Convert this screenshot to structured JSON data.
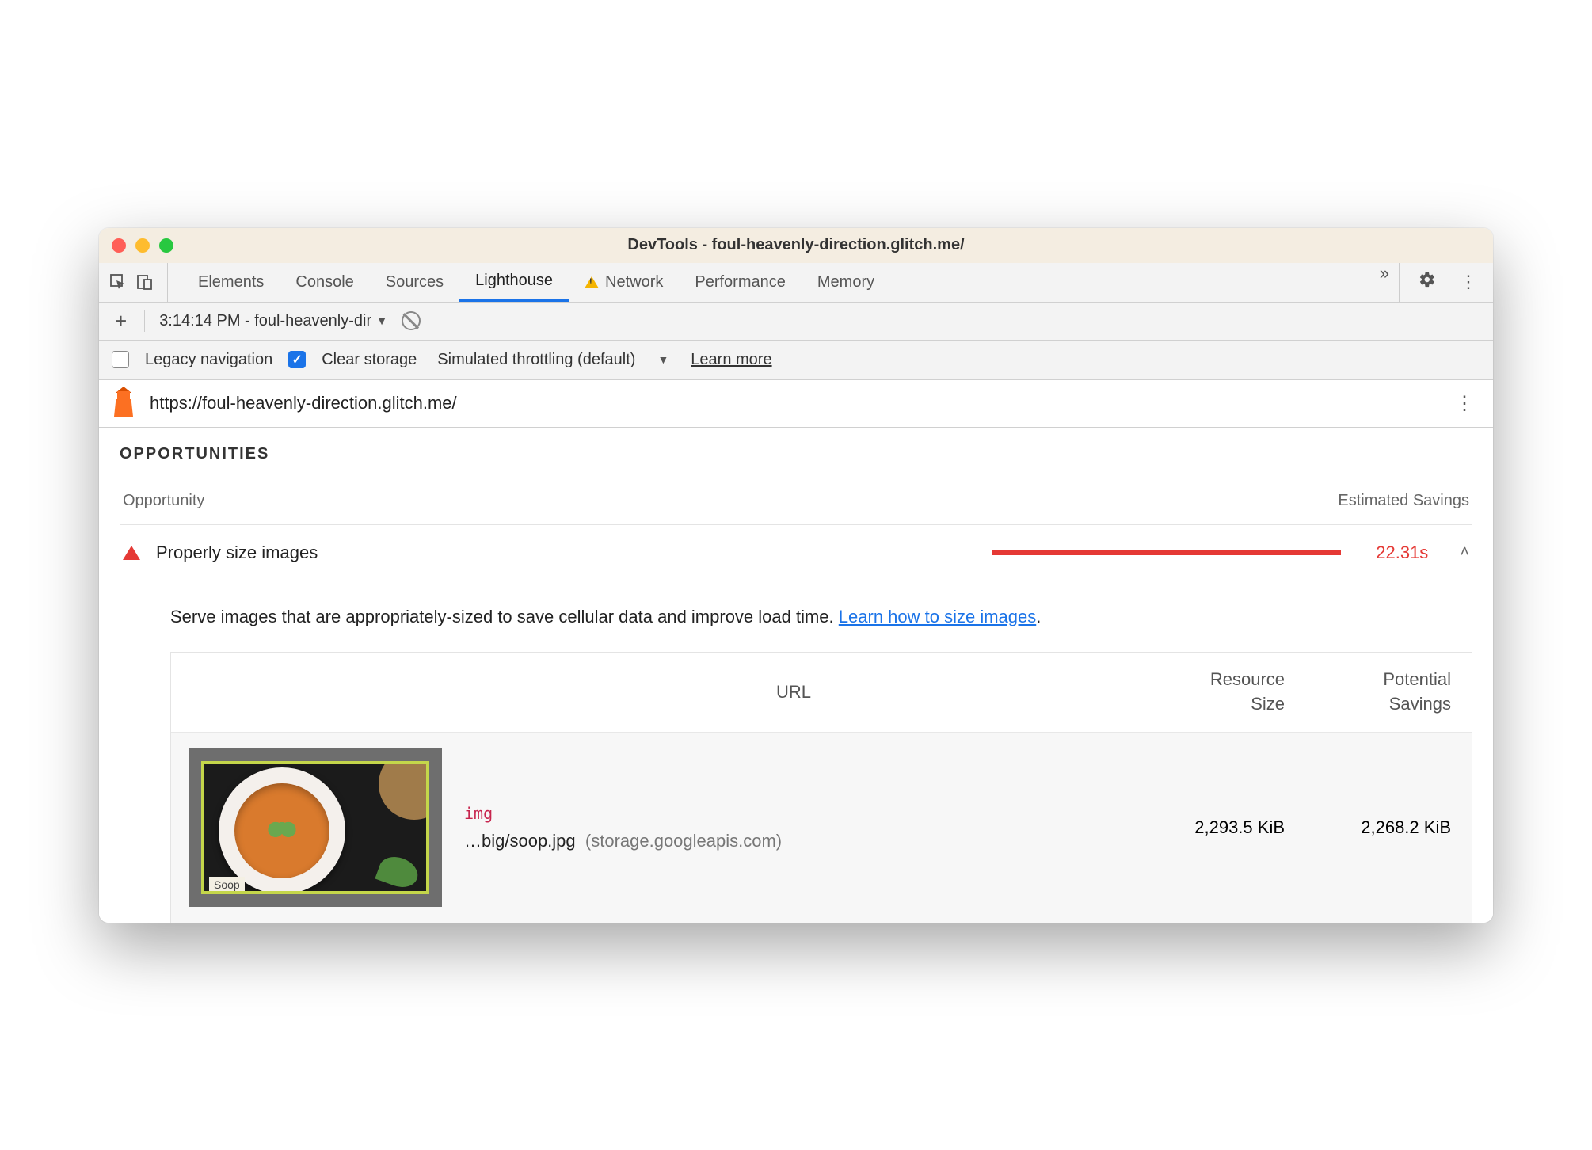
{
  "window": {
    "title": "DevTools - foul-heavenly-direction.glitch.me/"
  },
  "tabs": {
    "elements": "Elements",
    "console": "Console",
    "sources": "Sources",
    "lighthouse": "Lighthouse",
    "network": "Network",
    "performance": "Performance",
    "memory": "Memory"
  },
  "subbar": {
    "report": "3:14:14 PM - foul-heavenly-dir"
  },
  "options": {
    "legacy": "Legacy navigation",
    "clear": "Clear storage",
    "throttle": "Simulated throttling (default)",
    "learn": "Learn more"
  },
  "url": "https://foul-heavenly-direction.glitch.me/",
  "section": "OPPORTUNITIES",
  "cols": {
    "opp": "Opportunity",
    "est": "Estimated Savings"
  },
  "audit": {
    "label": "Properly size images",
    "savings": "22.31s",
    "desc1": "Serve images that are appropriately-sized to save cellular data and improve load time. ",
    "link": "Learn how to size images",
    "desc2": "."
  },
  "table": {
    "head": {
      "url": "URL",
      "rs1": "Resource",
      "rs2": "Size",
      "ps1": "Potential",
      "ps2": "Savings"
    },
    "row": {
      "tag": "img",
      "path": "…big/soop.jpg",
      "host": "(storage.googleapis.com)",
      "rsize": "2,293.5 KiB",
      "psize": "2,268.2 KiB",
      "caption": "Soop"
    }
  }
}
